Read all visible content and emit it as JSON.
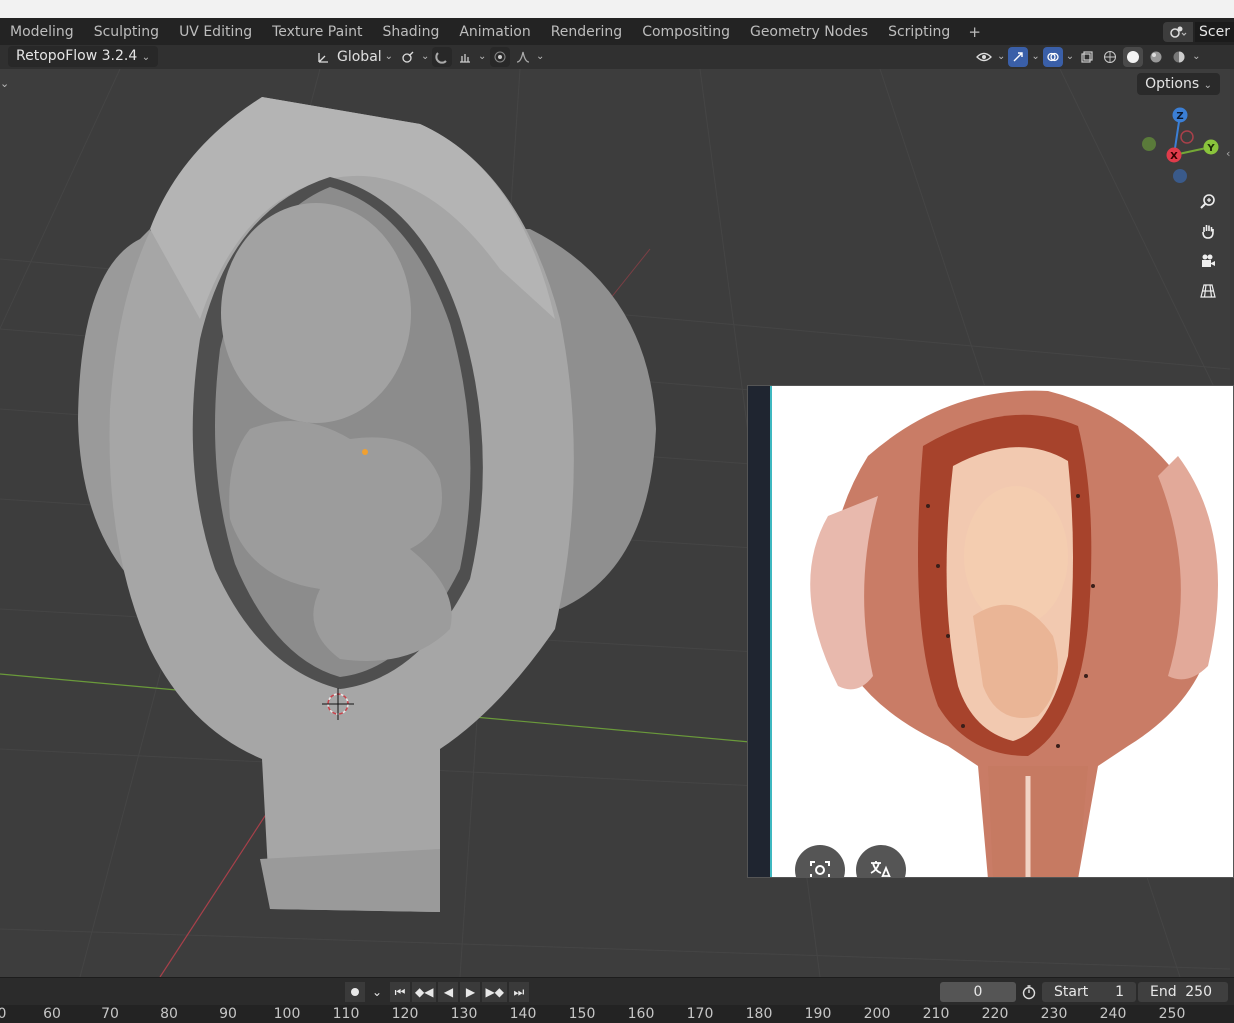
{
  "workspace_tabs": [
    "Modeling",
    "Sculpting",
    "UV Editing",
    "Texture Paint",
    "Shading",
    "Animation",
    "Rendering",
    "Compositing",
    "Geometry Nodes",
    "Scripting"
  ],
  "workspace_plus": "+",
  "scene_label": "Scer",
  "header": {
    "addon_label": "RetopoFlow 3.2.4",
    "transform_orientation": "Global"
  },
  "viewport": {
    "options_label": "Options",
    "gizmo": {
      "z": "Z",
      "x": "X",
      "y": "Y"
    }
  },
  "timeline": {
    "current_frame": "0",
    "start_label": "Start",
    "start_value": "1",
    "end_label": "End",
    "end_value": "250"
  },
  "ruler_ticks": [
    "0",
    "60",
    "70",
    "80",
    "90",
    "100",
    "110",
    "120",
    "130",
    "140",
    "150",
    "160",
    "170",
    "180",
    "190",
    "200",
    "210",
    "220",
    "230",
    "240",
    "250"
  ],
  "colors": {
    "axis_x": "#c8444c",
    "axis_y": "#74a836",
    "axis_z": "#3b7fd6",
    "mesh": "#a8a8a8",
    "accent": "#3a5fa8"
  }
}
